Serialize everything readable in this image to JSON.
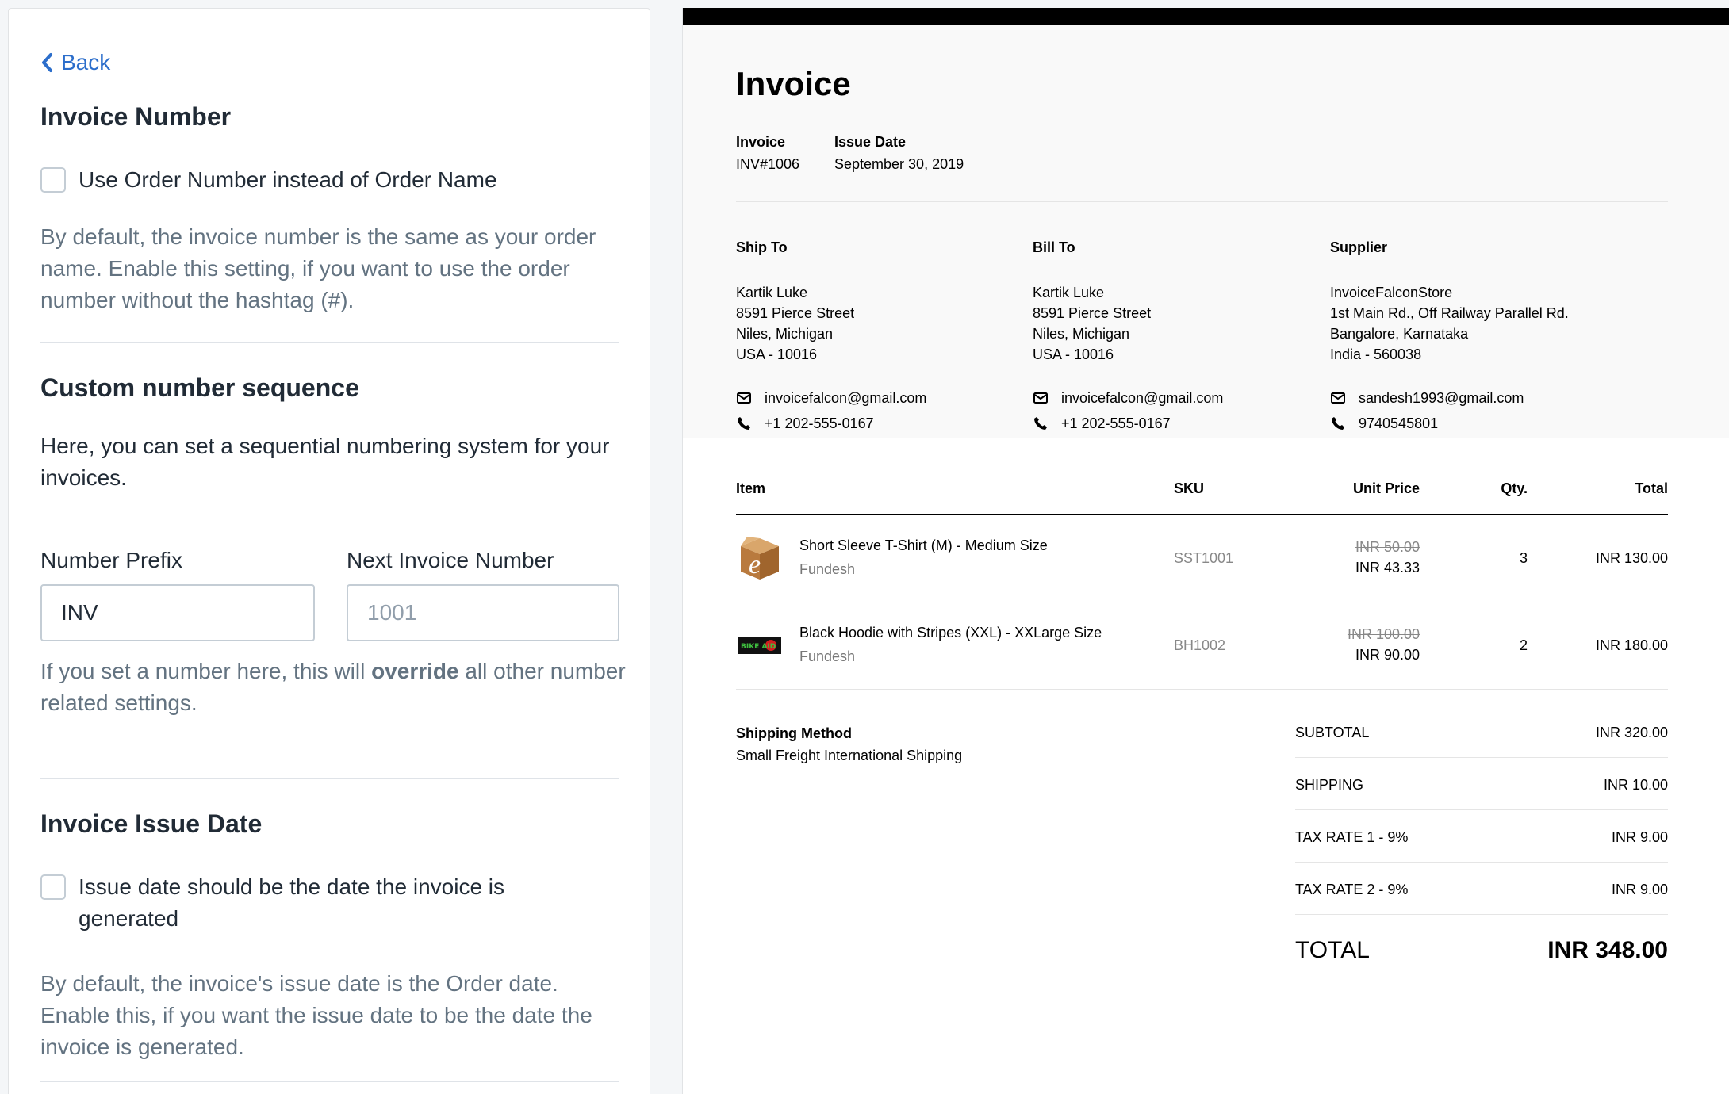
{
  "back_label": "Back",
  "invoice_number_section": {
    "title": "Invoice Number",
    "checkbox_label": "Use Order Number instead of Order Name",
    "help": "By default, the invoice number is the same as your order name. Enable this setting, if you want to use the order number without the hashtag (#)."
  },
  "custom_sequence": {
    "title": "Custom number sequence",
    "description": "Here, you can set a sequential numbering system for your invoices.",
    "prefix_label": "Number Prefix",
    "prefix_value": "INV",
    "next_label": "Next Invoice Number",
    "next_placeholder": "1001",
    "help_pre": "If you set a number here, this will ",
    "help_bold": "override",
    "help_post": " all other number related settings."
  },
  "issue_date_section": {
    "title": "Invoice Issue Date",
    "checkbox_label": "Issue date should be the date the invoice is generated",
    "help": "By default, the invoice's issue date is the Order date. Enable this, if you want the issue date to be the date the invoice is generated."
  },
  "invoice": {
    "title": "Invoice",
    "invoice_label": "Invoice",
    "invoice_value": "INV#1006",
    "issue_date_label": "Issue Date",
    "issue_date_value": "September 30, 2019",
    "ship_to": {
      "title": "Ship To",
      "lines": [
        "Kartik Luke",
        "8591 Pierce Street",
        "Niles, Michigan",
        "USA - 10016"
      ],
      "email": "invoicefalcon@gmail.com",
      "phone": "+1 202-555-0167"
    },
    "bill_to": {
      "title": "Bill To",
      "lines": [
        "Kartik Luke",
        "8591 Pierce Street",
        "Niles, Michigan",
        "USA - 10016"
      ],
      "email": "invoicefalcon@gmail.com",
      "phone": "+1 202-555-0167"
    },
    "supplier": {
      "title": "Supplier",
      "lines": [
        "InvoiceFalconStore",
        "1st Main Rd., Off Railway Parallel Rd.",
        "Bangalore, Karnataka",
        "India - 560038"
      ],
      "email": "sandesh1993@gmail.com",
      "phone": "9740545801"
    },
    "columns": {
      "item": "Item",
      "sku": "SKU",
      "unit_price": "Unit Price",
      "qty": "Qty.",
      "total": "Total"
    },
    "items": [
      {
        "name": "Short Sleeve T-Shirt (M) - Medium Size",
        "vendor": "Fundesh",
        "sku": "SST1001",
        "original_price": "INR 50.00",
        "price": "INR 43.33",
        "qty": "3",
        "total": "INR 130.00",
        "thumb_icon": "box-logo-icon"
      },
      {
        "name": "Black Hoodie with Stripes (XXL) - XXLarge Size",
        "vendor": "Fundesh",
        "sku": "BH1002",
        "original_price": "INR 100.00",
        "price": "INR 90.00",
        "qty": "2",
        "total": "INR 180.00",
        "thumb_icon": "bikeaid-logo-icon",
        "thumb_text": "BIKE AID"
      }
    ],
    "shipping_method_label": "Shipping Method",
    "shipping_method_value": "Small Freight International Shipping",
    "totals": {
      "subtotal_label": "SUBTOTAL",
      "subtotal": "INR 320.00",
      "shipping_label": "SHIPPING",
      "shipping": "INR 10.00",
      "tax1_label": "TAX RATE 1 - 9%",
      "tax1": "INR 9.00",
      "tax2_label": "TAX RATE 2 - 9%",
      "tax2": "INR 9.00",
      "total_label": "TOTAL",
      "total": "INR 348.00"
    }
  },
  "colors": {
    "link": "#2c6ecb",
    "help_text": "#637381",
    "text": "#212b36"
  }
}
